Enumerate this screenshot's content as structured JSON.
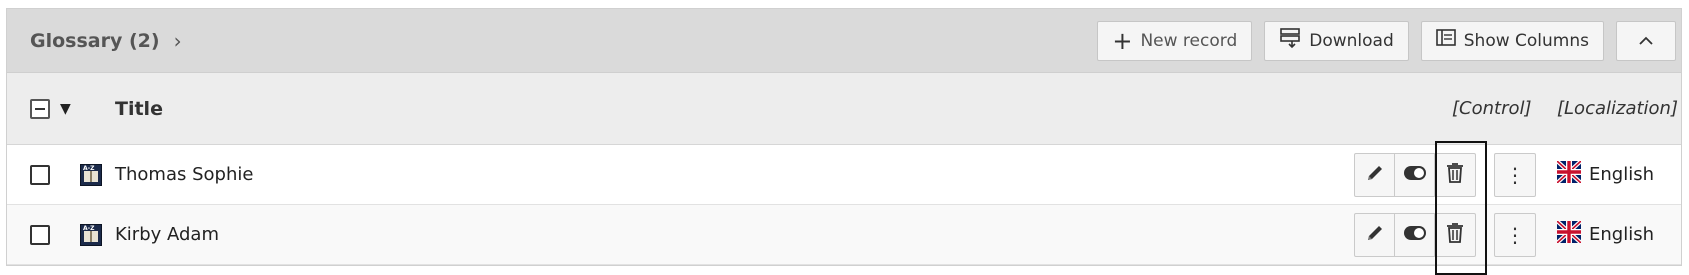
{
  "panel": {
    "title": "Glossary (2)",
    "actions": {
      "new_record": "New record",
      "download": "Download",
      "show_columns": "Show Columns"
    }
  },
  "columns": {
    "title": "Title",
    "control": "[Control]",
    "localization": "[Localization]"
  },
  "rows": [
    {
      "title": "Thomas Sophie",
      "language": "English"
    },
    {
      "title": "Kirby Adam",
      "language": "English"
    }
  ]
}
